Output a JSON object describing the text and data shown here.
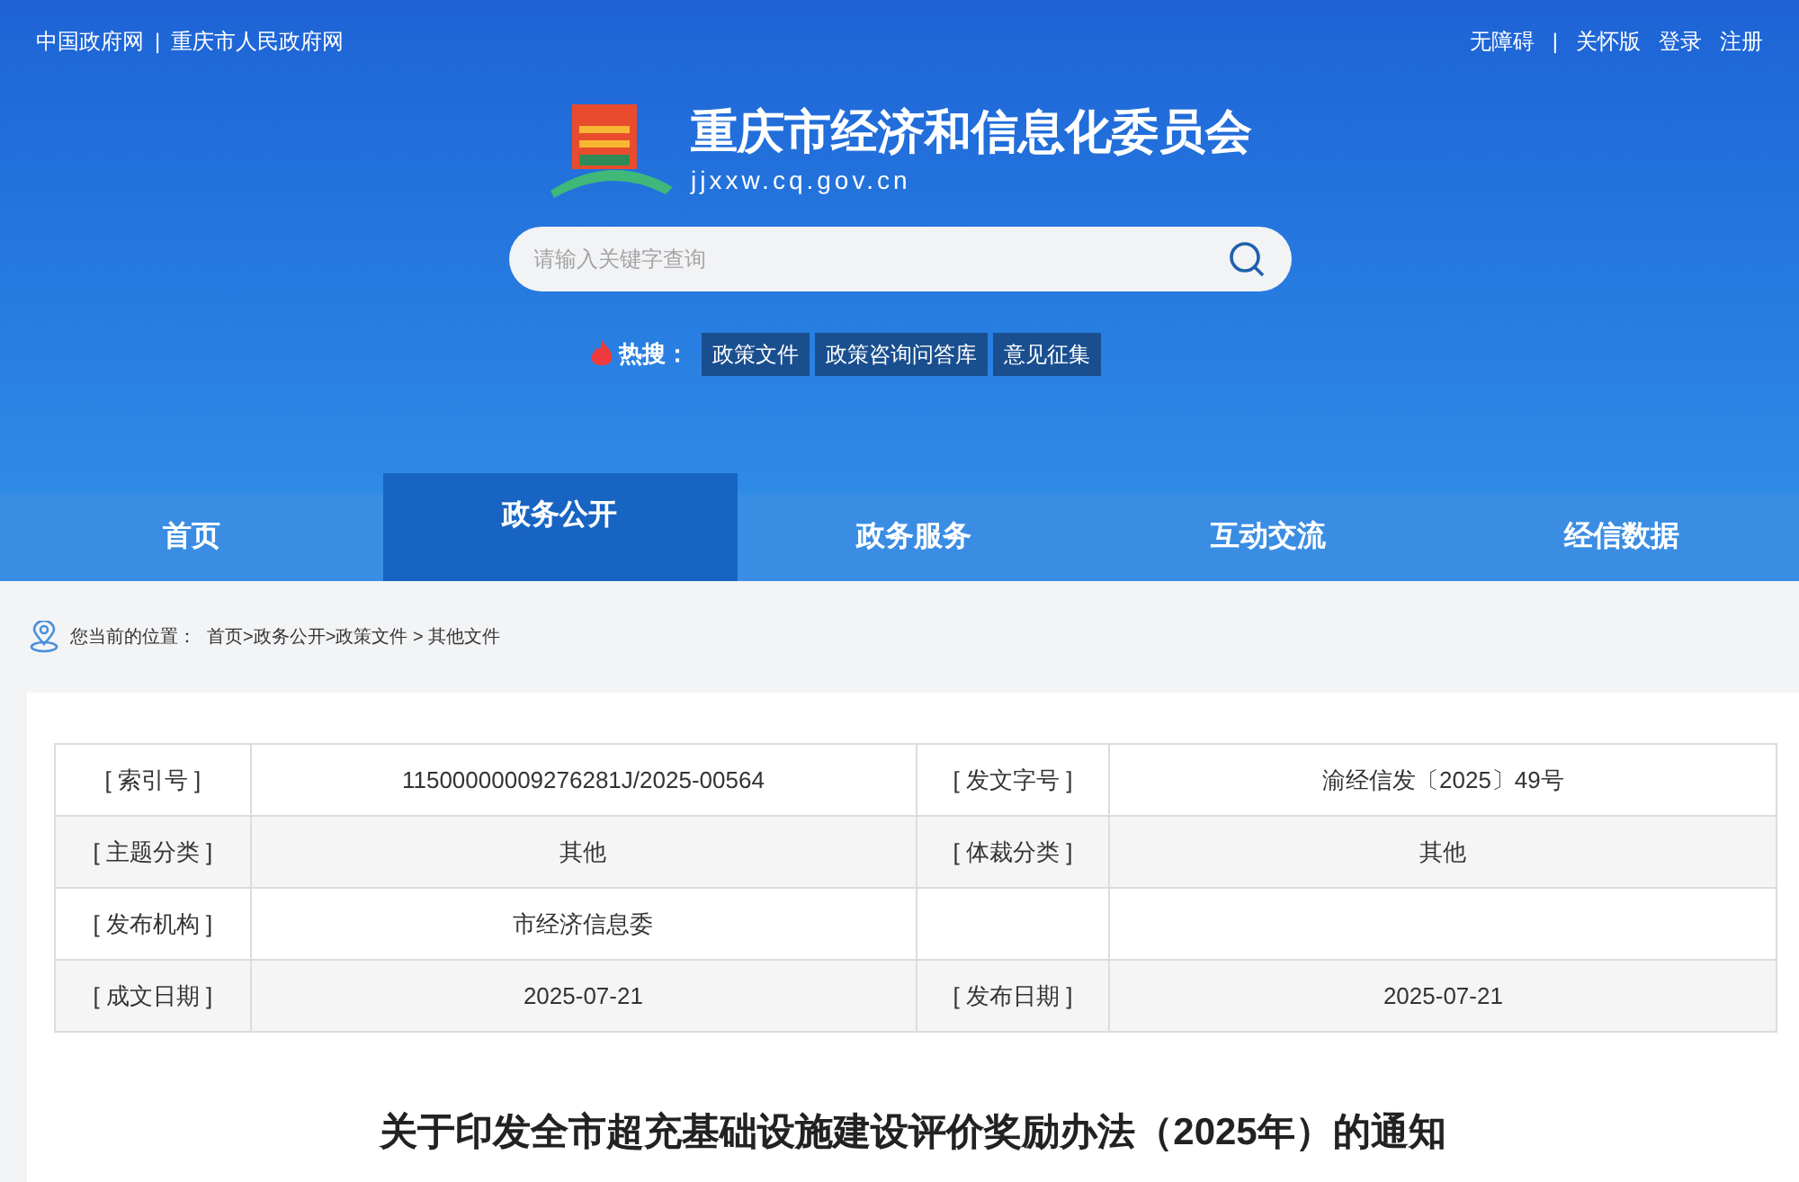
{
  "top_links_left": [
    "中国政府网",
    "重庆市人民政府网"
  ],
  "top_links_right": [
    "无障碍",
    "关怀版",
    "登录",
    "注册"
  ],
  "separator": "|",
  "site": {
    "name": "重庆市经济和信息化委员会",
    "domain": "jjxxw.cq.gov.cn"
  },
  "search": {
    "placeholder": "请输入关键字查询"
  },
  "hot_search": {
    "label": "热搜：",
    "items": [
      "政策文件",
      "政策咨询问答库",
      "意见征集"
    ]
  },
  "nav": [
    {
      "label": "首页",
      "selected": false
    },
    {
      "label": "政务公开",
      "selected": true
    },
    {
      "label": "政务服务",
      "selected": false
    },
    {
      "label": "互动交流",
      "selected": false
    },
    {
      "label": "经信数据",
      "selected": false
    }
  ],
  "breadcrumb": {
    "label": "您当前的位置：",
    "path": "首页>政务公开>政策文件 > 其他文件"
  },
  "info_table": [
    {
      "label_1": "[ 索引号 ]",
      "value_1": "11500000009276281J/2025-00564",
      "label_2": "[ 发文字号 ]",
      "value_2": "渝经信发〔2025〕49号"
    },
    {
      "label_1": "[ 主题分类 ]",
      "value_1": "其他",
      "label_2": "[ 体裁分类 ]",
      "value_2": "其他"
    },
    {
      "label_1": "[ 发布机构 ]",
      "value_1": "市经济信息委"
    },
    {
      "label_1": "[ 成文日期 ]",
      "value_1": "2025-07-21",
      "label_2": "[ 发布日期 ]",
      "value_2": "2025-07-21"
    }
  ],
  "article_title": "关于印发全市超充基础设施建设评价奖励办法（2025年）的通知"
}
